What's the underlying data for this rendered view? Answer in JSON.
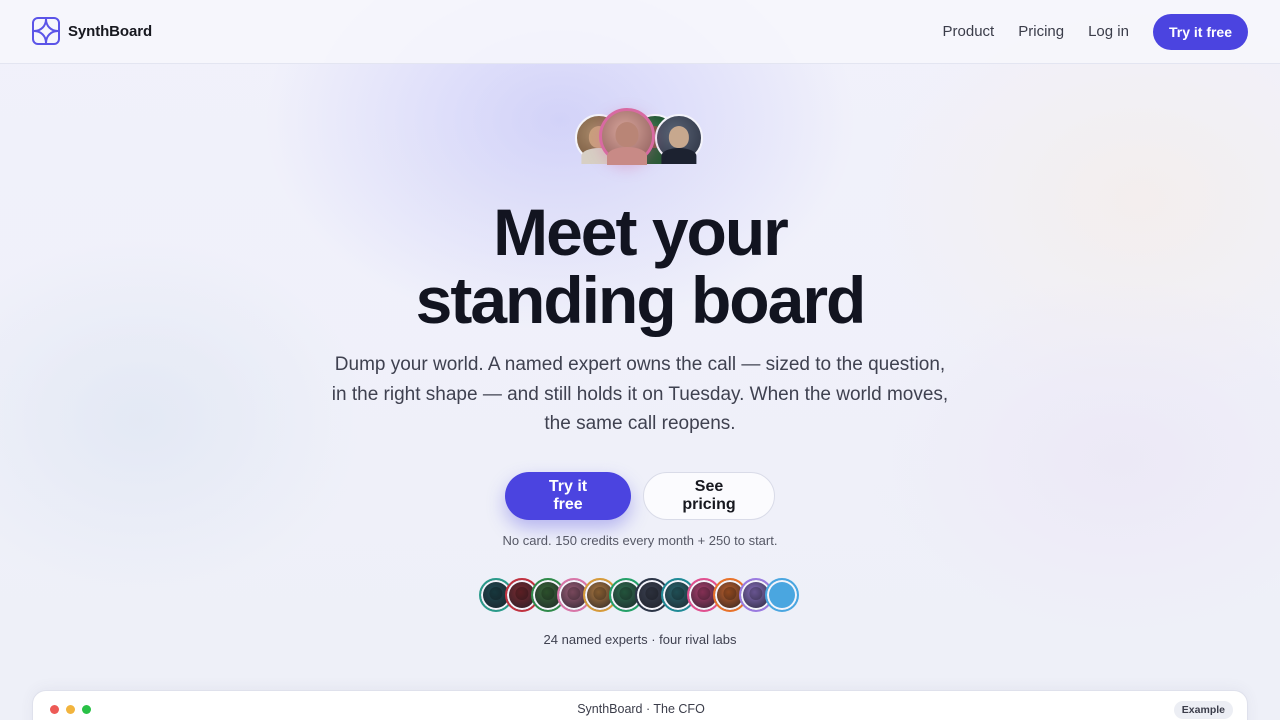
{
  "nav": {
    "brand": "SynthBoard",
    "links": [
      "Product",
      "Pricing",
      "Log in"
    ],
    "cta": "Try it free"
  },
  "hero": {
    "headline_line1": "Meet your",
    "headline_line2": "standing board",
    "subtitle": "Dump your world. A named expert owns the call — sized to the question, in the right shape — and still holds it on Tuesday. When the world moves, the same call reopens.",
    "primary_cta": "Try it free",
    "secondary_cta": "See pricing",
    "fineprint": "No card. 150 credits every month + 250 to start.",
    "experts_caption": "24 named experts · four rival labs"
  },
  "expert_ring_colors": [
    "#2a9a8a",
    "#c0313f",
    "#2f8a4a",
    "#d875a8",
    "#d69a3a",
    "#24a068",
    "#2b3446",
    "#1f8a96",
    "#e04f8f",
    "#e8722a",
    "#9a7ae0",
    "#4aa6e0"
  ],
  "preview_window": {
    "title": "SynthBoard · The CFO",
    "badge": "Example"
  },
  "colors": {
    "accent": "#4b44e0",
    "text": "#121420"
  }
}
